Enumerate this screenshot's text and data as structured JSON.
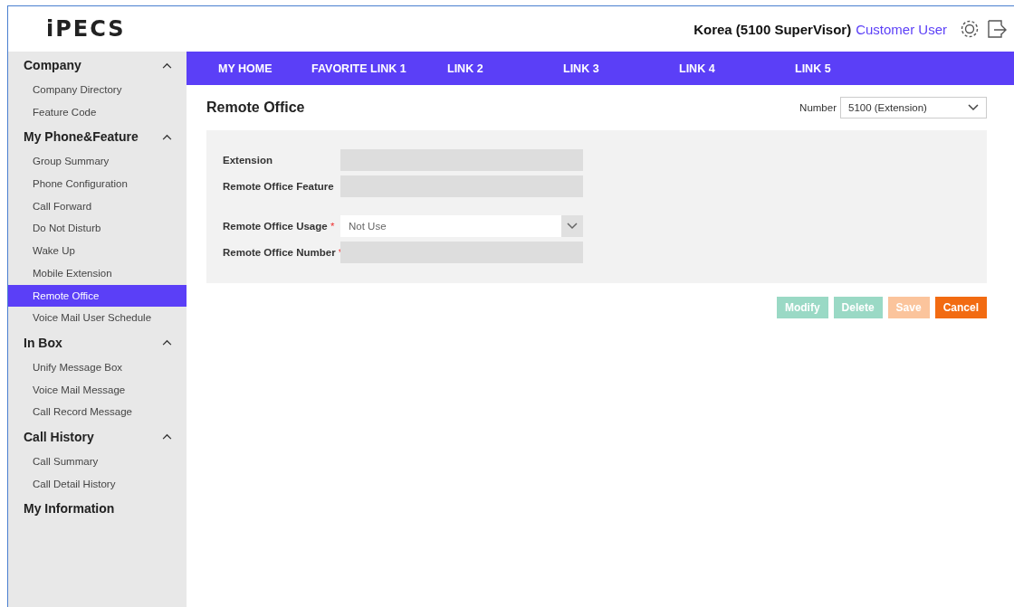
{
  "header": {
    "logo": "iPECS",
    "user_context": "Korea (5100 SuperVisor)",
    "user_name": "Customer User"
  },
  "sidebar": {
    "groups": [
      {
        "title": "Company",
        "expanded": true,
        "items": [
          {
            "label": "Company Directory",
            "selected": false
          },
          {
            "label": "Feature Code",
            "selected": false
          }
        ]
      },
      {
        "title": "My Phone&Feature",
        "expanded": true,
        "items": [
          {
            "label": "Group Summary",
            "selected": false
          },
          {
            "label": "Phone Configuration",
            "selected": false
          },
          {
            "label": "Call Forward",
            "selected": false
          },
          {
            "label": "Do Not Disturb",
            "selected": false
          },
          {
            "label": "Wake Up",
            "selected": false
          },
          {
            "label": "Mobile Extension",
            "selected": false
          },
          {
            "label": "Remote Office",
            "selected": true
          },
          {
            "label": "Voice Mail User Schedule",
            "selected": false
          }
        ]
      },
      {
        "title": "In Box",
        "expanded": true,
        "items": [
          {
            "label": "Unify Message Box",
            "selected": false
          },
          {
            "label": "Voice Mail Message",
            "selected": false
          },
          {
            "label": "Call Record Message",
            "selected": false
          }
        ]
      },
      {
        "title": "Call History",
        "expanded": true,
        "items": [
          {
            "label": "Call Summary",
            "selected": false
          },
          {
            "label": "Call Detail History",
            "selected": false
          }
        ]
      },
      {
        "title": "My Information"
      }
    ]
  },
  "nav": [
    "MY HOME",
    "FAVORITE LINK 1",
    "LINK 2",
    "LINK 3",
    "LINK 4",
    "LINK 5"
  ],
  "page": {
    "title": "Remote Office",
    "number_label": "Number",
    "number_value": "5100 (Extension)"
  },
  "form": {
    "sections": [
      {
        "fields": [
          {
            "label": "Extension",
            "kind": "readonly"
          },
          {
            "label": "Remote Office Feature",
            "kind": "readonly"
          }
        ]
      },
      {
        "fields": [
          {
            "label": "Remote Office Usage",
            "required_mark": "*",
            "kind": "select",
            "value": "Not Use"
          },
          {
            "label": "Remote Office Number",
            "required_mark": "*",
            "kind": "readonly"
          }
        ]
      }
    ]
  },
  "buttons": [
    {
      "label": "Modify",
      "kind": "edit",
      "disabled": true
    },
    {
      "label": "Delete",
      "kind": "edit",
      "disabled": true
    },
    {
      "label": "Save",
      "kind": "commit",
      "disabled": true
    },
    {
      "label": "Cancel",
      "kind": "commit",
      "disabled": false
    }
  ]
}
